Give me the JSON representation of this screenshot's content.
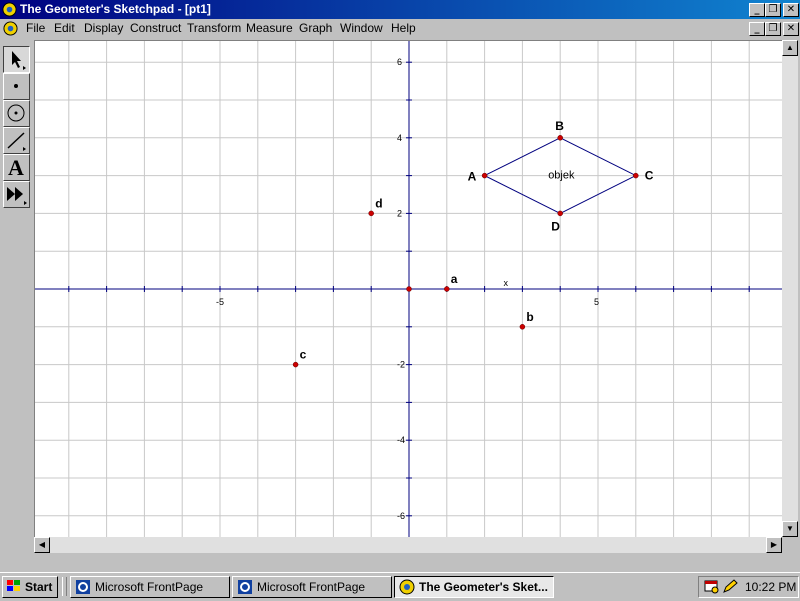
{
  "window": {
    "title": "The Geometer's Sketchpad - [pt1]"
  },
  "window_controls": {
    "minimize": "_",
    "restore": "❐",
    "close": "✕"
  },
  "menu": [
    "File",
    "Edit",
    "Display",
    "Construct",
    "Transform",
    "Measure",
    "Graph",
    "Window",
    "Help"
  ],
  "toolbox": [
    {
      "name": "selection-arrow-tool",
      "icon": "arrow-icon"
    },
    {
      "name": "point-tool",
      "icon": "point-icon"
    },
    {
      "name": "compass-tool",
      "icon": "circle-icon"
    },
    {
      "name": "straightedge-tool",
      "icon": "segment-icon"
    },
    {
      "name": "text-tool",
      "icon": "text-A-icon",
      "glyph": "A"
    },
    {
      "name": "script-tool",
      "icon": "fast-forward-icon"
    }
  ],
  "sketch": {
    "x_tick_labels": [
      {
        "value": -5,
        "text": "-5"
      },
      {
        "value": 5,
        "text": "5"
      }
    ],
    "y_tick_labels": [
      {
        "value": 6,
        "text": "6"
      },
      {
        "value": 4,
        "text": "4"
      },
      {
        "value": 2,
        "text": "2"
      },
      {
        "value": -2,
        "text": "-2"
      },
      {
        "value": -4,
        "text": "-4"
      },
      {
        "value": -6,
        "text": "-6"
      }
    ],
    "x_axis_label": "x",
    "points": [
      {
        "label": "a",
        "x": 1,
        "y": 0
      },
      {
        "label": "b",
        "x": 3,
        "y": -1
      },
      {
        "label": "c",
        "x": -3,
        "y": -2
      },
      {
        "label": "d",
        "x": -1,
        "y": 2
      }
    ],
    "origin_point": {
      "x": 0,
      "y": 0
    },
    "rhombus": {
      "vertices": [
        {
          "label": "A",
          "x": 2,
          "y": 3
        },
        {
          "label": "B",
          "x": 4,
          "y": 4
        },
        {
          "label": "C",
          "x": 6,
          "y": 3
        },
        {
          "label": "D",
          "x": 4,
          "y": 2
        }
      ],
      "caption": "objek"
    },
    "colors": {
      "axis": "#00007f",
      "grid": "#c8c8c8",
      "point": "#cc0000",
      "shape": "#00007f"
    }
  },
  "taskbar": {
    "start": "Start",
    "tasks": [
      {
        "label": "Microsoft FrontPage",
        "active": false
      },
      {
        "label": "Microsoft FrontPage",
        "active": false
      },
      {
        "label": "The Geometer's Sket...",
        "active": true
      }
    ],
    "clock": "10:22 PM"
  }
}
